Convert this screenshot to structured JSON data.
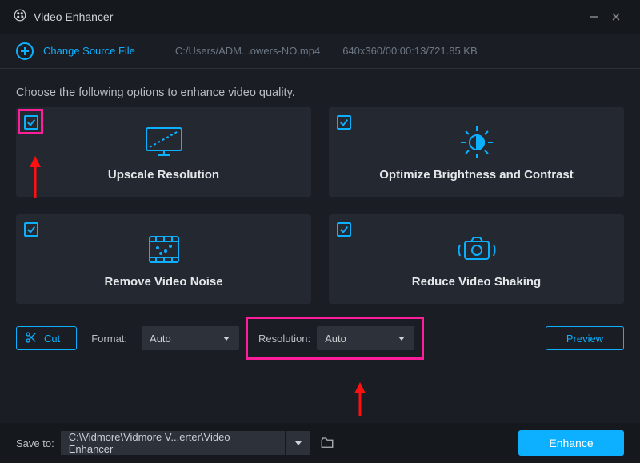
{
  "window": {
    "title": "Video Enhancer"
  },
  "source": {
    "change_label": "Change Source File",
    "path": "C:/Users/ADM...owers-NO.mp4",
    "info": "640x360/00:00:13/721.85 KB"
  },
  "intro": "Choose the following options to enhance video quality.",
  "cards": [
    {
      "label": "Upscale Resolution"
    },
    {
      "label": "Optimize Brightness and Contrast"
    },
    {
      "label": "Remove Video Noise"
    },
    {
      "label": "Reduce Video Shaking"
    }
  ],
  "controls": {
    "cut": "Cut",
    "format_label": "Format:",
    "format_value": "Auto",
    "resolution_label": "Resolution:",
    "resolution_value": "Auto",
    "preview": "Preview"
  },
  "bottom": {
    "save_label": "Save to:",
    "save_path": "C:\\Vidmore\\Vidmore V...erter\\Video Enhancer",
    "enhance": "Enhance"
  }
}
